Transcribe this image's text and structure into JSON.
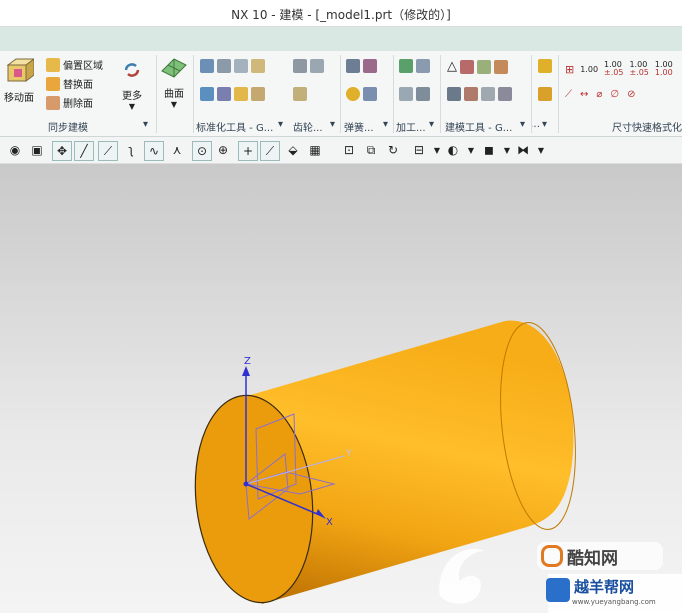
{
  "window": {
    "title": "NX 10 - 建模 - [_model1.prt（修改的）]"
  },
  "ribbon": {
    "move_face": "移动面",
    "offset_region": "偏置区域",
    "replace_face": "替换面",
    "delete_face": "删除面",
    "more": "更多",
    "surface": "曲面",
    "sync_modeling_group": "同步建模",
    "std_tools_group": "标准化工具 - G...",
    "gear_group": "齿轮...",
    "spring_group": "弹簧...",
    "machining_group": "加工...",
    "modeling_tools_group": "建模工具 - G...",
    "dim_group": "尺寸快速格式化",
    "dim_values": [
      "1.00",
      "1.00",
      "1.00",
      "1.00"
    ],
    "dim_sub": [
      "±.05",
      "±.05",
      "1.00"
    ],
    "ellipsis": "…"
  },
  "viewport": {
    "axis_z": "Z",
    "axis_x": "X",
    "axis_y": "Y",
    "body_color": "#f0a010",
    "face_color": "#e8980c",
    "background_top": "#c9c9c9"
  },
  "watermark": {
    "brand1": "酷知网",
    "brand2": "越羊帮网",
    "url": "www.yueyangbang.com"
  }
}
